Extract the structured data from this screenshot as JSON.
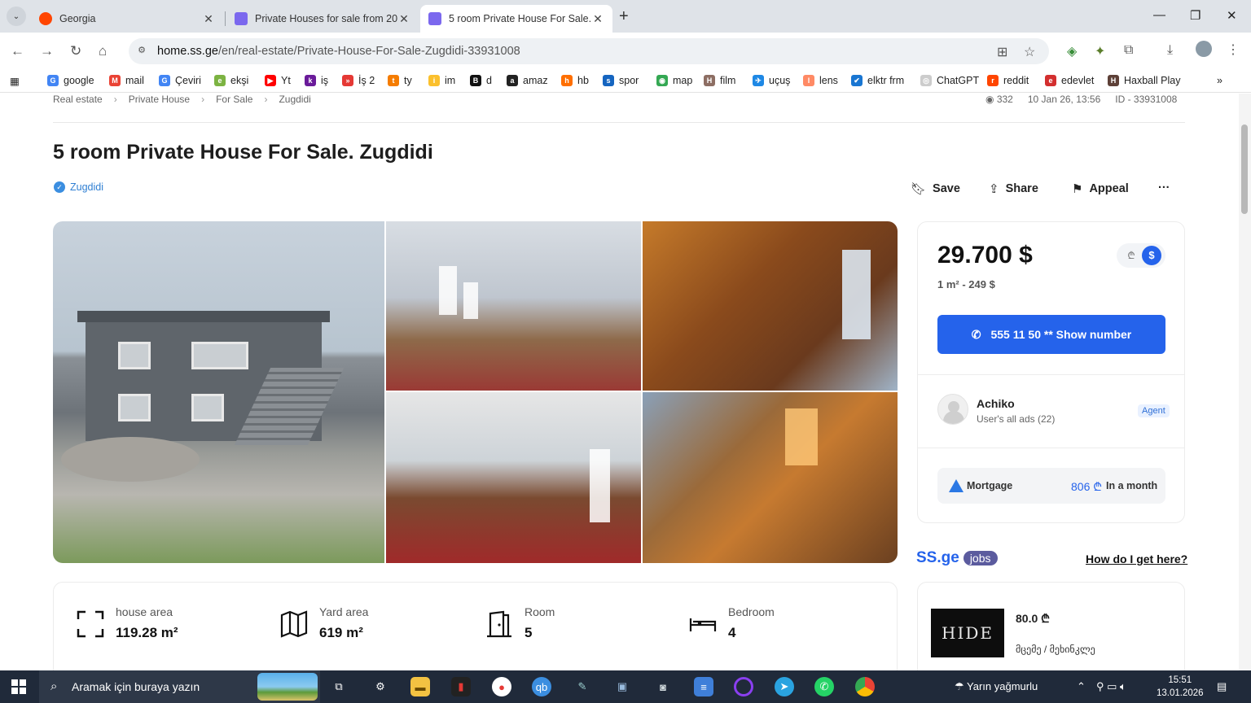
{
  "browser": {
    "tabs": [
      {
        "label": "Georgia",
        "favicon_color": "#ff4500"
      },
      {
        "label": "Private Houses for sale from 20",
        "favicon_color": "#7b68ee"
      },
      {
        "label": "5 room Private House For Sale.",
        "favicon_color": "#7b68ee"
      }
    ],
    "url_host": "home.ss.ge",
    "url_path": "/en/real-estate/Private-House-For-Sale-Zugdidi-33931008",
    "bookmarks": [
      {
        "label": "google",
        "color": "#4285f4",
        "glyph": "G"
      },
      {
        "label": "mail",
        "color": "#ea4335",
        "glyph": "M"
      },
      {
        "label": "Çeviri",
        "color": "#4285f4",
        "glyph": "G"
      },
      {
        "label": "ekşi",
        "color": "#7cb342",
        "glyph": "e"
      },
      {
        "label": "Yt",
        "color": "#ff0000",
        "glyph": "▶"
      },
      {
        "label": "iş",
        "color": "#6a1b9a",
        "glyph": "k"
      },
      {
        "label": "İş 2",
        "color": "#e53935",
        "glyph": "»"
      },
      {
        "label": "ty",
        "color": "#f57c00",
        "glyph": "t"
      },
      {
        "label": "im",
        "color": "#fbc02d",
        "glyph": "i"
      },
      {
        "label": "d",
        "color": "#111111",
        "glyph": "B"
      },
      {
        "label": "amaz",
        "color": "#222222",
        "glyph": "a"
      },
      {
        "label": "hb",
        "color": "#ff6f00",
        "glyph": "h"
      },
      {
        "label": "spor",
        "color": "#1565c0",
        "glyph": "s"
      },
      {
        "label": "map",
        "color": "#34a853",
        "glyph": "◉"
      },
      {
        "label": "film",
        "color": "#8d6e63",
        "glyph": "H"
      },
      {
        "label": "uçuş",
        "color": "#1e88e5",
        "glyph": "✈"
      },
      {
        "label": "lens",
        "color": "#ff8a65",
        "glyph": "l"
      },
      {
        "label": "elktr frm",
        "color": "#1976d2",
        "glyph": "✔"
      },
      {
        "label": "ChatGPT",
        "color": "#cccccc",
        "glyph": "◎"
      },
      {
        "label": "reddit",
        "color": "#ff4500",
        "glyph": "r"
      },
      {
        "label": "edevlet",
        "color": "#d32f2f",
        "glyph": "e"
      },
      {
        "label": "Haxball Play",
        "color": "#5d4037",
        "glyph": "H"
      }
    ]
  },
  "page": {
    "crumbs": [
      "Real estate",
      "Private House",
      "For Sale",
      "Zugdidi"
    ],
    "views": "332",
    "date": "10 Jan 26, 13:56",
    "ad_id": "ID - 33931008",
    "title": "5 room Private House For Sale. Zugdidi",
    "location": "Zugdidi",
    "actions": {
      "save": "Save",
      "share": "Share",
      "appeal": "Appeal",
      "more": "···"
    }
  },
  "listing": {
    "price": "29.700 $",
    "currency_gel": "₾",
    "currency_usd": "$",
    "price_per_m2": "1 m² - 249 $",
    "phone_label": "555 11 50 ** Show number",
    "seller_name": "Achiko",
    "seller_ads": "User's all ads (22)",
    "seller_badge": "Agent",
    "mortgage_label": "Mortgage",
    "mortgage_value": "806 ₾",
    "mortgage_unit": "In a month"
  },
  "specs": [
    {
      "label": "house area",
      "value": "119.28 m²"
    },
    {
      "label": "Yard area",
      "value": "619 m²"
    },
    {
      "label": "Room",
      "value": "5"
    },
    {
      "label": "Bedroom",
      "value": "4"
    }
  ],
  "jobs": {
    "brand": "SS.ge",
    "pill": "jobs",
    "link": "How do I get here?",
    "logo_text": "HIDE",
    "salary": "80.0 ₾",
    "position": "მცემე / მეხინკლე"
  },
  "taskbar": {
    "search_placeholder": "Aramak için buraya yazın",
    "weather": "Yarın yağmurlu",
    "time": "15:51",
    "date": "13.01.2026"
  }
}
